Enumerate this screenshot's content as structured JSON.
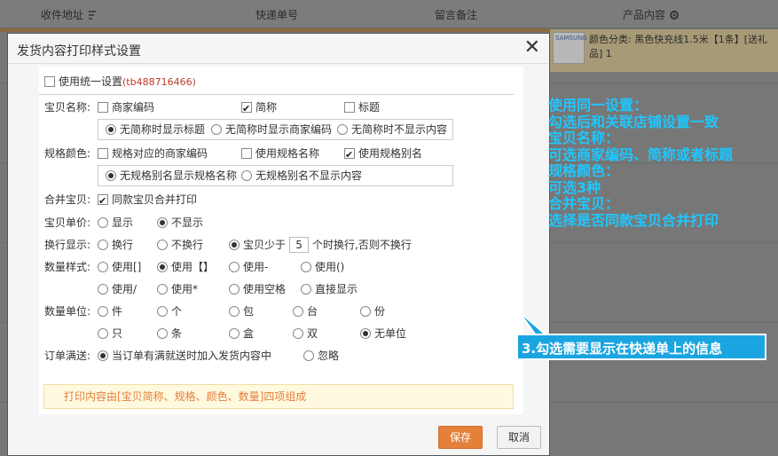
{
  "bg": {
    "columns": [
      "收件地址",
      "快递单号",
      "留言备注",
      "产品内容"
    ],
    "product_thumb_text": "SAMSUNG",
    "product_text": "颜色分类: 黑色快充线1.5米【1条】[送礼品] 1"
  },
  "dialog": {
    "title": "发货内容打印样式设置",
    "close": "✕",
    "unify": {
      "label": "使用统一设置",
      "shop": "(tb488716466)"
    },
    "baobei_name": {
      "label": "宝贝名称:",
      "options": [
        "商家编码",
        "简称",
        "标题"
      ],
      "sub": [
        "无简称时显示标题",
        "无简称时显示商家编码",
        "无简称时不显示内容"
      ]
    },
    "sku": {
      "label": "规格颜色:",
      "options": [
        "规格对应的商家编码",
        "使用规格名称",
        "使用规格别名"
      ],
      "sub": [
        "无规格别名显示规格名称",
        "无规格别名不显示内容"
      ]
    },
    "merge": {
      "label": "合并宝贝:",
      "option": "同款宝贝合并打印"
    },
    "price": {
      "label": "宝贝单价:",
      "options": [
        "显示",
        "不显示"
      ]
    },
    "wrap": {
      "label": "换行显示:",
      "options": [
        "换行",
        "不换行"
      ],
      "less_prefix": "宝贝少于",
      "less_value": "5",
      "less_suffix": "个时换行,否则不换行"
    },
    "qty_style": {
      "label": "数量样式:",
      "row1": [
        "使用[]",
        "使用【】",
        "使用-",
        "使用()"
      ],
      "row2": [
        "使用/",
        "使用*",
        "使用空格",
        "直接显示"
      ]
    },
    "qty_unit": {
      "label": "数量单位:",
      "row1": [
        "件",
        "个",
        "包",
        "台",
        "份"
      ],
      "row2": [
        "只",
        "条",
        "盒",
        "双",
        "无单位"
      ]
    },
    "order_gift": {
      "label": "订单满送:",
      "options": [
        "当订单有满就送时加入发货内容中",
        "忽略"
      ]
    },
    "note": "打印内容由[宝贝简称、规格、颜色、数量]四项组成",
    "save": "保存",
    "cancel": "取消"
  },
  "annotation": {
    "lines": [
      "使用同一设置：",
      "勾选后和关联店铺设置一致",
      "宝贝名称：",
      "可选商家编码、简称或者标题",
      "规格颜色：",
      "可选3种",
      "合并宝贝：",
      "选择是否同款宝贝合并打印"
    ],
    "callout": "3.勾选需要显示在快递单上的信息"
  },
  "colors": {
    "accent": "#e5803a",
    "annotation": "#1ec7ff",
    "callout_bg": "#1ba5e0"
  }
}
